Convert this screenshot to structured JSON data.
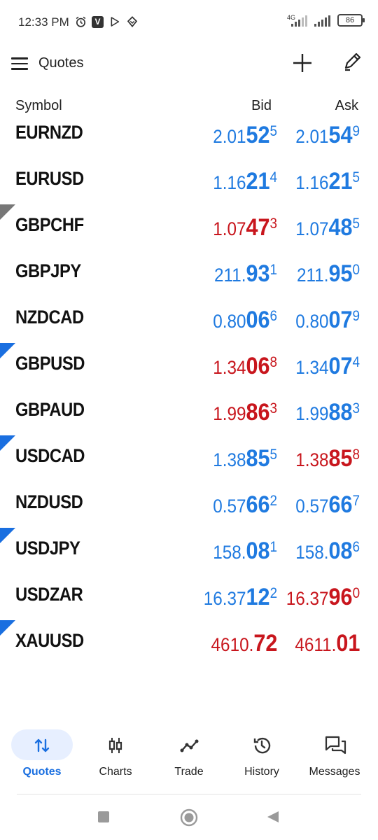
{
  "status_bar": {
    "time": "12:33 PM",
    "network": "4G",
    "battery": "86",
    "icons": [
      "alarm-icon",
      "v-app-icon",
      "play-store-icon",
      "location-app-icon"
    ]
  },
  "app_bar": {
    "title": "Quotes",
    "icons": [
      "menu-icon",
      "add-icon",
      "edit-icon"
    ]
  },
  "columns": {
    "symbol": "Symbol",
    "bid": "Bid",
    "ask": "Ask"
  },
  "colors": {
    "up": "#1f7ae0",
    "down": "#c8161d",
    "accent": "#1a6fe0",
    "pill": "#e7efff"
  },
  "quotes": [
    {
      "symbol": "EURNZD",
      "flag": "none",
      "bid": {
        "pre": "2.01",
        "big": "52",
        "pip": "5",
        "color": "blue"
      },
      "ask": {
        "pre": "2.01",
        "big": "54",
        "pip": "9",
        "color": "blue"
      }
    },
    {
      "symbol": "EURUSD",
      "flag": "none",
      "bid": {
        "pre": "1.16",
        "big": "21",
        "pip": "4",
        "color": "blue"
      },
      "ask": {
        "pre": "1.16",
        "big": "21",
        "pip": "5",
        "color": "blue"
      }
    },
    {
      "symbol": "GBPCHF",
      "flag": "down",
      "bid": {
        "pre": "1.07",
        "big": "47",
        "pip": "3",
        "color": "red"
      },
      "ask": {
        "pre": "1.07",
        "big": "48",
        "pip": "5",
        "color": "blue"
      }
    },
    {
      "symbol": "GBPJPY",
      "flag": "none",
      "bid": {
        "pre": "211.",
        "big": "93",
        "pip": "1",
        "color": "blue"
      },
      "ask": {
        "pre": "211.",
        "big": "95",
        "pip": "0",
        "color": "blue"
      }
    },
    {
      "symbol": "NZDCAD",
      "flag": "none",
      "bid": {
        "pre": "0.80",
        "big": "06",
        "pip": "6",
        "color": "blue"
      },
      "ask": {
        "pre": "0.80",
        "big": "07",
        "pip": "9",
        "color": "blue"
      }
    },
    {
      "symbol": "GBPUSD",
      "flag": "up",
      "bid": {
        "pre": "1.34",
        "big": "06",
        "pip": "8",
        "color": "red"
      },
      "ask": {
        "pre": "1.34",
        "big": "07",
        "pip": "4",
        "color": "blue"
      }
    },
    {
      "symbol": "GBPAUD",
      "flag": "none",
      "bid": {
        "pre": "1.99",
        "big": "86",
        "pip": "3",
        "color": "red"
      },
      "ask": {
        "pre": "1.99",
        "big": "88",
        "pip": "3",
        "color": "blue"
      }
    },
    {
      "symbol": "USDCAD",
      "flag": "up",
      "bid": {
        "pre": "1.38",
        "big": "85",
        "pip": "5",
        "color": "blue"
      },
      "ask": {
        "pre": "1.38",
        "big": "85",
        "pip": "8",
        "color": "red"
      }
    },
    {
      "symbol": "NZDUSD",
      "flag": "none",
      "bid": {
        "pre": "0.57",
        "big": "66",
        "pip": "2",
        "color": "blue"
      },
      "ask": {
        "pre": "0.57",
        "big": "66",
        "pip": "7",
        "color": "blue"
      }
    },
    {
      "symbol": "USDJPY",
      "flag": "up",
      "bid": {
        "pre": "158.",
        "big": "08",
        "pip": "1",
        "color": "blue"
      },
      "ask": {
        "pre": "158.",
        "big": "08",
        "pip": "6",
        "color": "blue"
      }
    },
    {
      "symbol": "USDZAR",
      "flag": "none",
      "bid": {
        "pre": "16.37",
        "big": "12",
        "pip": "2",
        "color": "blue"
      },
      "ask": {
        "pre": "16.37",
        "big": "96",
        "pip": "0",
        "color": "red"
      }
    },
    {
      "symbol": "XAUUSD",
      "flag": "up",
      "bid": {
        "pre": "4610.",
        "big": "72",
        "pip": "",
        "color": "red"
      },
      "ask": {
        "pre": "4611.",
        "big": "01",
        "pip": "",
        "color": "red"
      }
    }
  ],
  "bottom_nav": [
    {
      "label": "Quotes",
      "icon": "quotes-arrows-icon",
      "active": true
    },
    {
      "label": "Charts",
      "icon": "charts-candles-icon",
      "active": false
    },
    {
      "label": "Trade",
      "icon": "trade-line-icon",
      "active": false
    },
    {
      "label": "History",
      "icon": "history-clock-icon",
      "active": false
    },
    {
      "label": "Messages",
      "icon": "messages-chat-icon",
      "active": false
    }
  ],
  "system_nav": [
    "recents-square-icon",
    "home-circle-icon",
    "back-triangle-icon"
  ]
}
